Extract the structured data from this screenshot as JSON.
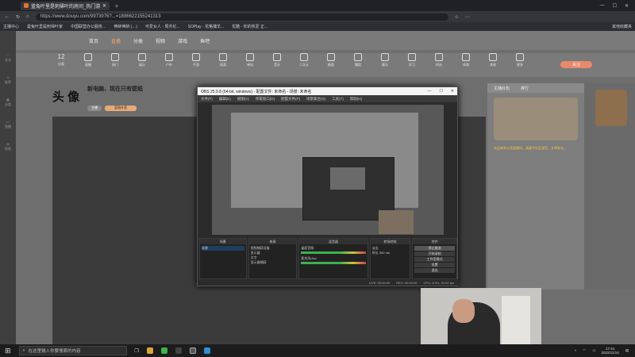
{
  "browser": {
    "tab_title": "蓝兔叶里是刺帰叶的房间_热门游戏",
    "url": "https://www.douyu.com/9973976?...=1896622155241313",
    "bookmarks": [
      "主播中心",
      "曼兔叶里是刺帰叶家",
      "中国联营办公服务...",
      "伸醉伸醉:(…)",
      "可爱女人 - 周杰伦...",
      "SOPlay - 花格捕羊...",
      "优酷 - 你的热爱 正..."
    ],
    "bookmarks_right": "其他收藏夹"
  },
  "site": {
    "logo": "斗鱼",
    "nav": [
      "首页",
      "直播",
      "分类",
      "视频",
      "游戏",
      "鱼吧"
    ],
    "categories": [
      "分类",
      "直播",
      "热门",
      "娱乐",
      "户外",
      "手游",
      "网游",
      "单机",
      "音乐",
      "二次元",
      "颜值",
      "舞蹈",
      "聊天",
      "学习",
      "科技",
      "体育",
      "其他",
      "更多"
    ],
    "follow_count": "12",
    "fixed_button": "关注",
    "stream_title": "新电脑、现在只有壁纸",
    "avatar_text": "头 像",
    "badge_small": "主播",
    "badge_tag": "蓝兔叶里",
    "side_panel_tabs": [
      "主播红包",
      "排行"
    ],
    "notice": "欢迎来到斗鱼直播间，请遵守社区规范，文明发言。",
    "left_items": [
      "关注",
      "推荐",
      "分类",
      "直播",
      "鱼吧"
    ]
  },
  "obs": {
    "title": "OBS 25.0.8 (64-bit, windows) - 配置文件: 未命名 - 场景: 未命名",
    "menu": [
      "文件(F)",
      "编辑(E)",
      "视图(V)",
      "停靠窗口(D)",
      "配置文件(P)",
      "场景集合(S)",
      "工具(T)",
      "帮助(H)"
    ],
    "docks": {
      "scenes": "场景",
      "sources": "来源",
      "mixer": "混音器",
      "transitions": "转场特效",
      "controls": "控件"
    },
    "scene_list": [
      "场景"
    ],
    "source_list": [
      "视频捕获设备",
      "显示器",
      "文字",
      "显示器捕获"
    ],
    "mixer_items": [
      "桌面音频",
      "麦克风/Aux"
    ],
    "transition_type": "淡出",
    "duration_label": "时长",
    "duration_value": "300 ms",
    "controls": [
      "停止推流",
      "开始录制",
      "工作室模式",
      "设置",
      "退出"
    ],
    "status": [
      "LIVE: 00:00:00",
      "REC: 00:00:00",
      "CPU: 3.9%, 30.00 fps"
    ]
  },
  "taskbar": {
    "search_placeholder": "在这里输入你要搜索的内容",
    "time": "17:41",
    "date": "2022/11/14"
  }
}
